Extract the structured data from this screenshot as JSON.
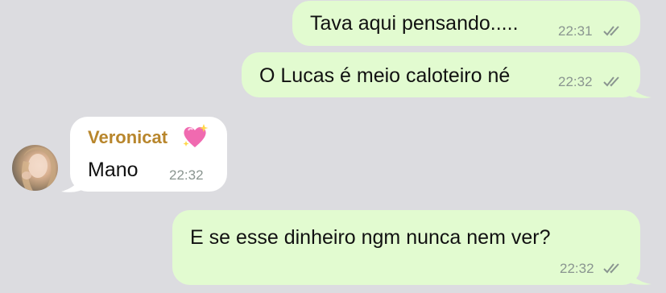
{
  "messages": [
    {
      "direction": "outgoing",
      "text": "Tava aqui pensando.....",
      "time": "22:31",
      "status": "read"
    },
    {
      "direction": "outgoing",
      "text": "O Lucas é meio caloteiro né",
      "time": "22:32",
      "status": "read"
    },
    {
      "direction": "incoming",
      "sender": "Veronicat",
      "sender_emoji": "💖",
      "text": "Mano",
      "time": "22:32",
      "avatar": "avatar-photo"
    },
    {
      "direction": "outgoing",
      "text": "E se esse dinheiro ngm nunca nem ver?",
      "time": "22:32",
      "status": "read"
    }
  ],
  "colors": {
    "background": "#dcdce0",
    "outgoing_bubble": "#e2fbd0",
    "incoming_bubble": "#ffffff",
    "sender_name": "#b8862c",
    "timestamp": "#8a9590"
  }
}
